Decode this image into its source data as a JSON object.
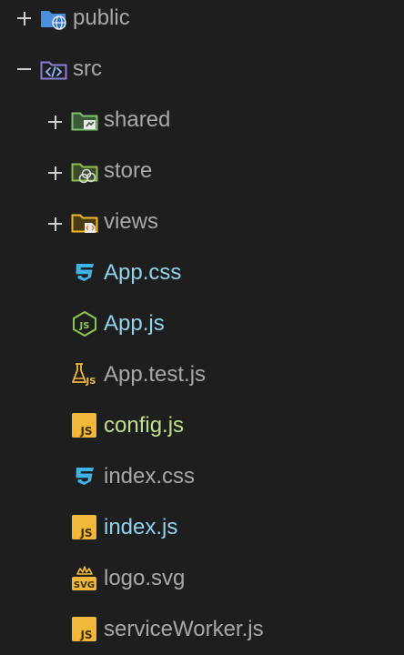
{
  "explorer": {
    "items": [
      {
        "label": "public",
        "color": "#a8a8a8",
        "expander": "+",
        "icon": "folder-globe-icon"
      },
      {
        "label": "src",
        "color": "#a8a8a8",
        "expander": "−",
        "icon": "folder-code-icon"
      },
      {
        "label": "shared",
        "color": "#a8a8a8",
        "expander": "+",
        "icon": "folder-shared-icon"
      },
      {
        "label": "store",
        "color": "#a8a8a8",
        "expander": "+",
        "icon": "folder-store-icon"
      },
      {
        "label": "views",
        "color": "#a8a8a8",
        "expander": "+",
        "icon": "folder-views-icon"
      },
      {
        "label": "App.css",
        "color": "#8fd3ee",
        "icon": "css-icon"
      },
      {
        "label": "App.js",
        "color": "#8fd3ee",
        "icon": "nodejs-icon"
      },
      {
        "label": "App.test.js",
        "color": "#a8a8a8",
        "icon": "test-flask-icon"
      },
      {
        "label": "config.js",
        "color": "#bfe08a",
        "icon": "javascript-icon"
      },
      {
        "label": "index.css",
        "color": "#a8a8a8",
        "icon": "css-icon"
      },
      {
        "label": "index.js",
        "color": "#8fd3ee",
        "icon": "javascript-icon"
      },
      {
        "label": "logo.svg",
        "color": "#a8a8a8",
        "icon": "svg-icon"
      },
      {
        "label": "serviceWorker.js",
        "color": "#a8a8a8",
        "icon": "javascript-icon"
      }
    ]
  }
}
